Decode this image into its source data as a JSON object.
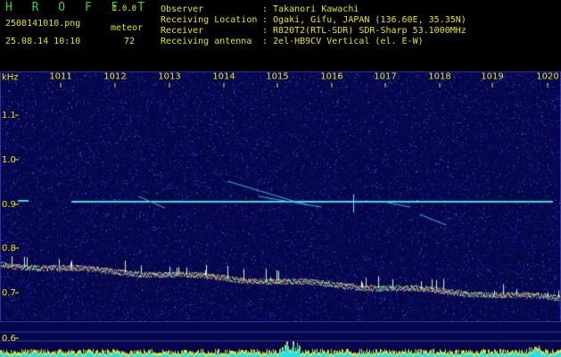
{
  "app": {
    "name": "H R O F F T",
    "version": "1.0.0"
  },
  "file": {
    "name": "2508141010.png",
    "datetime": "25.08.14 10:10"
  },
  "meteor": {
    "label": "meteor",
    "count": "72"
  },
  "info": [
    {
      "key": "Observer",
      "value": ": Takanori Kawachi"
    },
    {
      "key": "Receiving Location",
      "value": ": Ogaki, Gifu, JAPAN (136.60E, 35.35N)"
    },
    {
      "key": "Receiver",
      "value": ": R820T2(RTL-SDR) SDR-Sharp 53.1000MHz"
    },
    {
      "key": "Receiving antenna",
      "value": ": 2el-HB9CV Vertical (el. E-W)"
    }
  ],
  "axis": {
    "unit": "kHz",
    "x_ticks": [
      "1011",
      "1012",
      "1013",
      "1014",
      "1015",
      "1016",
      "1017",
      "1018",
      "1019",
      "1020"
    ],
    "y_ticks": [
      "1.1",
      "1.0",
      "0.9",
      "0.8",
      "0.7",
      "0.6"
    ]
  },
  "colors": {
    "text": "#e8e800",
    "title": "#39d23a",
    "background": "#000000",
    "noise": "#0b0b6e"
  }
}
